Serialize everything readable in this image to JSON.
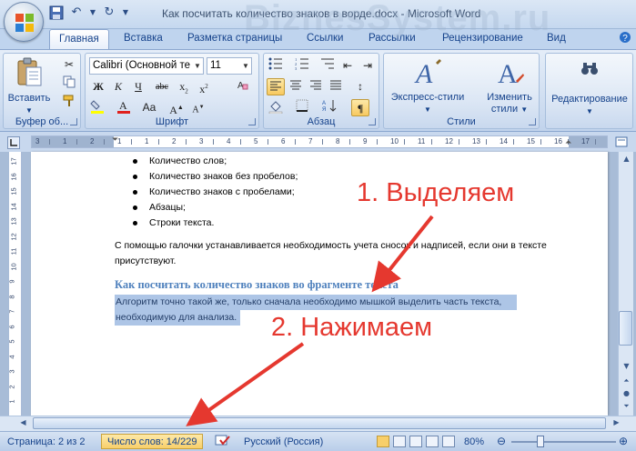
{
  "window": {
    "title": "Как посчитать количество знаков в ворде.docx - Microsoft Word",
    "watermark": "BiznesSystem.ru"
  },
  "tabs": [
    {
      "label": "Главная",
      "active": true
    },
    {
      "label": "Вставка"
    },
    {
      "label": "Разметка страницы"
    },
    {
      "label": "Ссылки"
    },
    {
      "label": "Рассылки"
    },
    {
      "label": "Рецензирование"
    },
    {
      "label": "Вид"
    }
  ],
  "ribbon": {
    "clipboard": {
      "label": "Буфер об...",
      "paste_label": "Вставить"
    },
    "font": {
      "label": "Шрифт",
      "font_name": "Calibri (Основной те",
      "font_size": "11"
    },
    "paragraph": {
      "label": "Абзац"
    },
    "styles": {
      "label": "Стили",
      "express_line1": "Экспресс-стили",
      "change_line1": "Изменить",
      "change_line2": "стили"
    },
    "editing": {
      "label": "Редактирование"
    }
  },
  "ruler": {
    "numbers": [
      "3",
      "1",
      "2",
      "1",
      "1",
      "2",
      "3",
      "4",
      "5",
      "6",
      "7",
      "8",
      "9",
      "10",
      "11",
      "12",
      "13",
      "14",
      "15",
      "16",
      "17"
    ]
  },
  "vruler": {
    "numbers": [
      "17",
      "16",
      "15",
      "14",
      "13",
      "12",
      "11",
      "10",
      "9",
      "8",
      "7",
      "6",
      "5",
      "4",
      "3",
      "2",
      "1"
    ]
  },
  "document": {
    "bullets": [
      "Количество слов;",
      "Количество знаков без пробелов;",
      "Количество знаков с пробелами;",
      "Абзацы;",
      "Строки текста."
    ],
    "paragraph_line1": "С помощью галочки устанавливается необходимость учета сносок и надписей, если они в тексте",
    "paragraph_line2": "присутствуют.",
    "heading": "Как посчитать количество знаков во фрагменте текста",
    "selected_line1": "Алгоритм точно такой же, только сначала необходимо мышкой выделить часть текста,",
    "selected_line2": "необходимую для анализа."
  },
  "annotations": {
    "step1": "1. Выделяем",
    "step2": "2. Нажимаем",
    "color": "#e5382f"
  },
  "status": {
    "page": "Страница: 2 из 2",
    "words": "Число слов: 14/229",
    "language": "Русский (Россия)",
    "zoom": "80%"
  }
}
